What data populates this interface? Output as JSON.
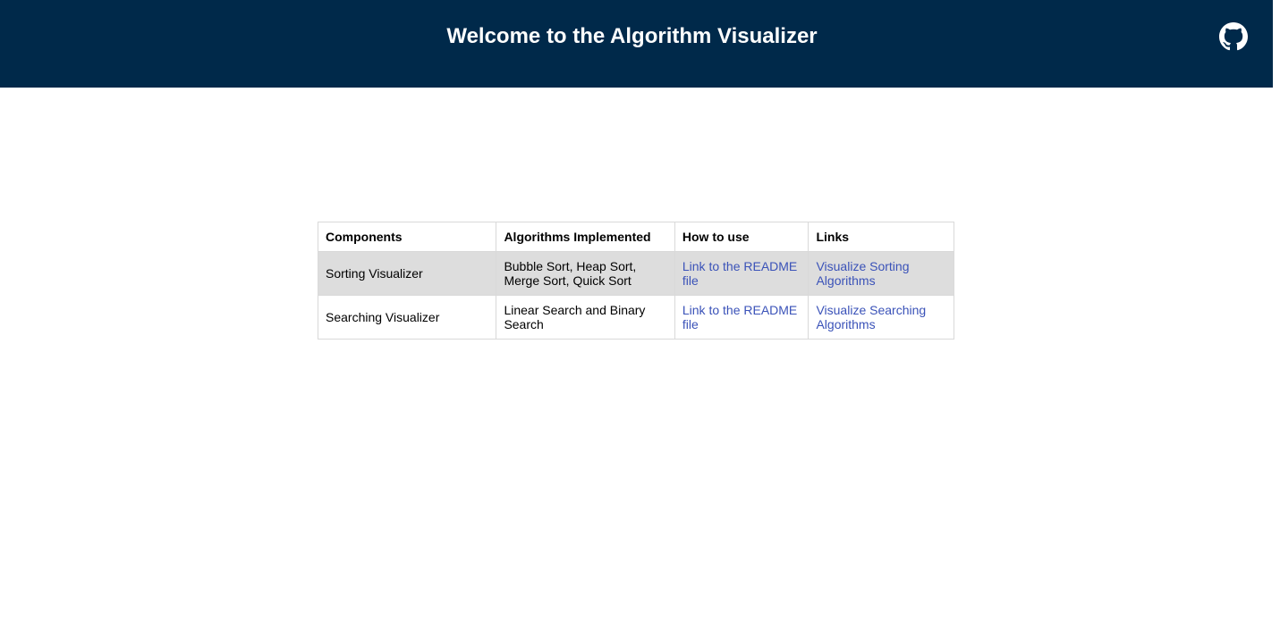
{
  "header": {
    "title": "Welcome to the Algorithm Visualizer",
    "background_color": "#00294a",
    "github_icon": "github-icon"
  },
  "table": {
    "headers": [
      "Components",
      "Algorithms Implemented",
      "How to use",
      "Links"
    ],
    "rows": [
      {
        "component": "Sorting Visualizer",
        "algorithms": "Bubble Sort, Heap Sort, Merge Sort, Quick Sort",
        "how_to_use": "Link to the README file",
        "link": "Visualize Sorting Algorithms"
      },
      {
        "component": "Searching Visualizer",
        "algorithms": "Linear Search and Binary Search",
        "how_to_use": "Link to the README file",
        "link": "Visualize Searching Algorithms"
      }
    ],
    "link_color": "#3a52b8",
    "shaded_row_color": "#dddddd"
  }
}
